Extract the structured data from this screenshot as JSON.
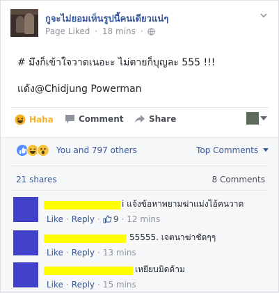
{
  "post": {
    "page_name": "กูจะไม่ยอมเห็นรูปนี้คนเดียวแน่ๆ",
    "status": "Page Liked",
    "dot": "·",
    "time": "18 mins",
    "text_line1": "# มึงก็เข้าใจวาดเนอะะ ไม่ตายก็บุญละ 555 !!!",
    "text_line2": "แด้ง@Chidjung Powerman"
  },
  "actions": {
    "haha_label": "Haha",
    "comment_label": "Comment",
    "share_label": "Share"
  },
  "reactions": {
    "summary_text": "You and 797 others",
    "top_comments_label": "Top Comments",
    "shares_text": "21 shares",
    "comments_count_text": "8 Comments"
  },
  "comments": [
    {
      "text": "i แจ้งข้อหาพยามฆ่าแม่งไอ้คนวาด",
      "like": "Like",
      "reply": "Reply",
      "likes_count": "9",
      "time": "12 mins",
      "sep": "·"
    },
    {
      "text": "55555. เจตนาฆ่าชัดๆๆ",
      "like": "Like",
      "reply": "Reply",
      "time": "13 mins",
      "sep": "·"
    },
    {
      "text": "เหยียบมิดด้าม",
      "like": "Like",
      "reply": "Reply",
      "time": "15 mins",
      "sep": "·"
    }
  ],
  "colors": {
    "link_blue": "#365899",
    "haha_yellow": "#f7b125",
    "redaction_yellow": "#ffff00",
    "avatar_blue": "#4040c8"
  },
  "icons": {
    "globe": "globe-icon",
    "chevron": "chevron-down-icon",
    "haha": "haha-icon",
    "comment": "comment-icon",
    "share": "share-icon"
  }
}
